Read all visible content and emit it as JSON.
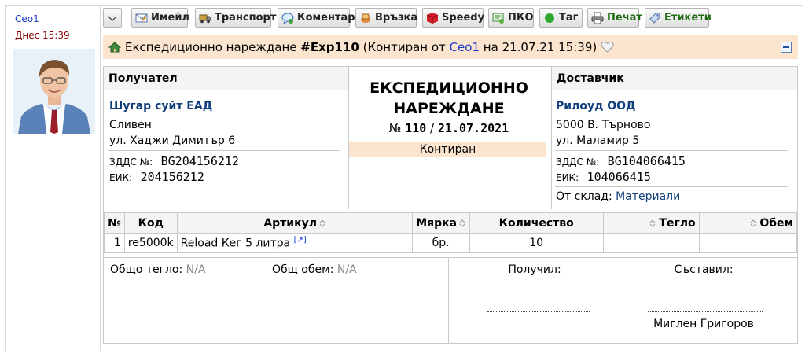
{
  "author": {
    "name": "Ceo1",
    "date": "Днес 15:39"
  },
  "toolbar": {
    "email": "Имейл",
    "transport": "Транспорт",
    "comment": "Коментар",
    "link": "Връзка",
    "speedy": "Speedy",
    "pko": "ПКО",
    "tag": "Таг",
    "print": "Печат",
    "labels": "Етикети"
  },
  "titlebar": {
    "prefix": "Експедиционно нареждане",
    "doc_id": "#Exp110",
    "status_prefix": "(Контиран от",
    "user": "Ceo1",
    "status_suffix": "на 21.07.21 15:39)"
  },
  "receiver": {
    "heading": "Получател",
    "name": "Шугар суйт ЕАД",
    "city": "Сливен",
    "address": "ул. Хаджи Димитър 6",
    "vat_label": "ЗДДС №:",
    "vat": "BG204156212",
    "eik_label": "ЕИК:",
    "eik": "204156212"
  },
  "document": {
    "title_line1": "ЕКСПЕДИЦИОННО",
    "title_line2": "НАРЕЖДАНЕ",
    "num_label": "№",
    "number": "110",
    "separator": "/",
    "date": "21.07.2021",
    "status": "Контиран"
  },
  "supplier": {
    "heading": "Доставчик",
    "name": "Рилоуд ООД",
    "city": "5000 В. Търново",
    "address": "ул. Маламир 5",
    "vat_label": "ЗДДС №:",
    "vat": "BG104066415",
    "eik_label": "ЕИК:",
    "eik": "104066415",
    "store_label": "От склад:",
    "store": "Материали"
  },
  "items_table": {
    "headers": [
      "№",
      "Код",
      "Артикул",
      "Мярка",
      "Количество",
      "Тегло",
      "Обем"
    ],
    "rows": [
      {
        "no": "1",
        "code": "re5000k",
        "article": "Reload Кег 5 литра",
        "ext": "[↗]",
        "unit": "бр.",
        "qty": "10",
        "weight": "",
        "volume": ""
      }
    ]
  },
  "totals": {
    "weight_label": "Общо тегло:",
    "weight_value": "N/A",
    "volume_label": "Общ обем:",
    "volume_value": "N/A"
  },
  "signatures": {
    "received_label": "Получил:",
    "received_name": "",
    "composed_label": "Съставил:",
    "composed_name": "Миглен Григоров"
  }
}
